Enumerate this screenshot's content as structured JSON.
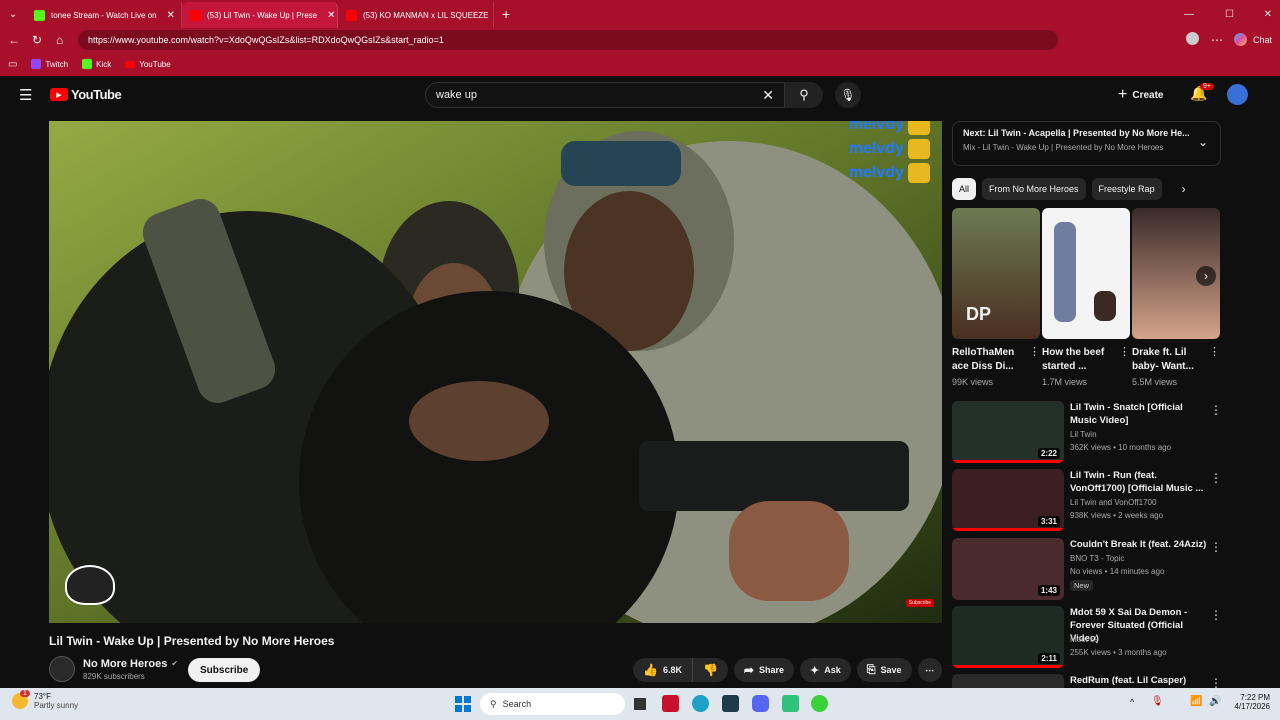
{
  "browser": {
    "tabs": [
      {
        "label": "tonee Stream - Watch Live on",
        "color": "#53fc18"
      },
      {
        "label": "(53) Lil Twin - Wake Up | Prese",
        "color": "#ff0000"
      },
      {
        "label": "(53) KO MANMAN x LIL SQUEEZE",
        "color": "#ff0000"
      }
    ],
    "url": "https://www.youtube.com/watch?v=XdoQwQGsIZs&list=RDXdoQwQGsIZs&start_radio=1",
    "bookmarks": [
      "Twitch",
      "Kick",
      "YouTube"
    ],
    "chat_label": "Chat"
  },
  "youtube": {
    "logo": "YouTube",
    "search_value": "wake up",
    "create_label": "Create",
    "notif_badge": "9+"
  },
  "video": {
    "overlay_names": [
      "melvdy",
      "melvdy",
      "melvdy"
    ],
    "watermark": "Subscribe",
    "title": "Lil Twin - Wake Up | Presented by No More Heroes",
    "channel": "No More Heroes",
    "subscribers": "829K subscribers",
    "subscribe_label": "Subscribe",
    "likes": "6.8K",
    "share_label": "Share",
    "ask_label": "Ask",
    "save_label": "Save"
  },
  "sidebar": {
    "next_label": "Next:",
    "next_title": "Lil Twin - Acapella | Presented by No More He...",
    "next_sub": "Mix - Lil Twin - Wake Up | Presented by No More Heroes",
    "chips": [
      "All",
      "From No More Heroes",
      "Freestyle Rap"
    ],
    "shorts": [
      {
        "title": "RelloThaMen ace Diss Di...",
        "views": "99K views",
        "overlay": "DP"
      },
      {
        "title": "How the beef started ...",
        "views": "1.7M views",
        "overlay": ""
      },
      {
        "title": "Drake ft. Lil baby- Want...",
        "views": "5.5M views",
        "overlay": ""
      }
    ],
    "recs": [
      {
        "title": "Lil Twin - Snatch [Official Music Video]",
        "channel": "Lil Twin",
        "meta": "362K views • 10 months ago",
        "duration": "2:22",
        "progress": 1.0,
        "badge": ""
      },
      {
        "title": "Lil Twin - Run (feat. VonOff1700) [Official Music ...",
        "channel": "Lil Twin and VonOff1700",
        "meta": "938K views • 2 weeks ago",
        "duration": "3:31",
        "progress": 1.0,
        "badge": ""
      },
      {
        "title": "Couldn't Break It (feat. 24Aziz)",
        "channel": "BNO T3 - Topic",
        "meta": "No views • 14 minutes ago",
        "duration": "1:43",
        "progress": 0.0,
        "badge": "New"
      },
      {
        "title": "Mdot 59 X Sai Da Demon - Forever Situated (Official Video)",
        "channel": "Mdot 59",
        "meta": "255K views • 3 months ago",
        "duration": "2:11",
        "progress": 1.0,
        "badge": ""
      },
      {
        "title": "RedRum (feat. Lil Casper)",
        "channel": "",
        "meta": "",
        "duration": "",
        "progress": 0.0,
        "badge": ""
      }
    ]
  },
  "taskbar": {
    "weather_temp": "73°F",
    "weather_desc": "Partly sunny",
    "weather_badge": "1",
    "search_placeholder": "Search",
    "time": "7:22 PM",
    "date": "4/17/2026"
  }
}
